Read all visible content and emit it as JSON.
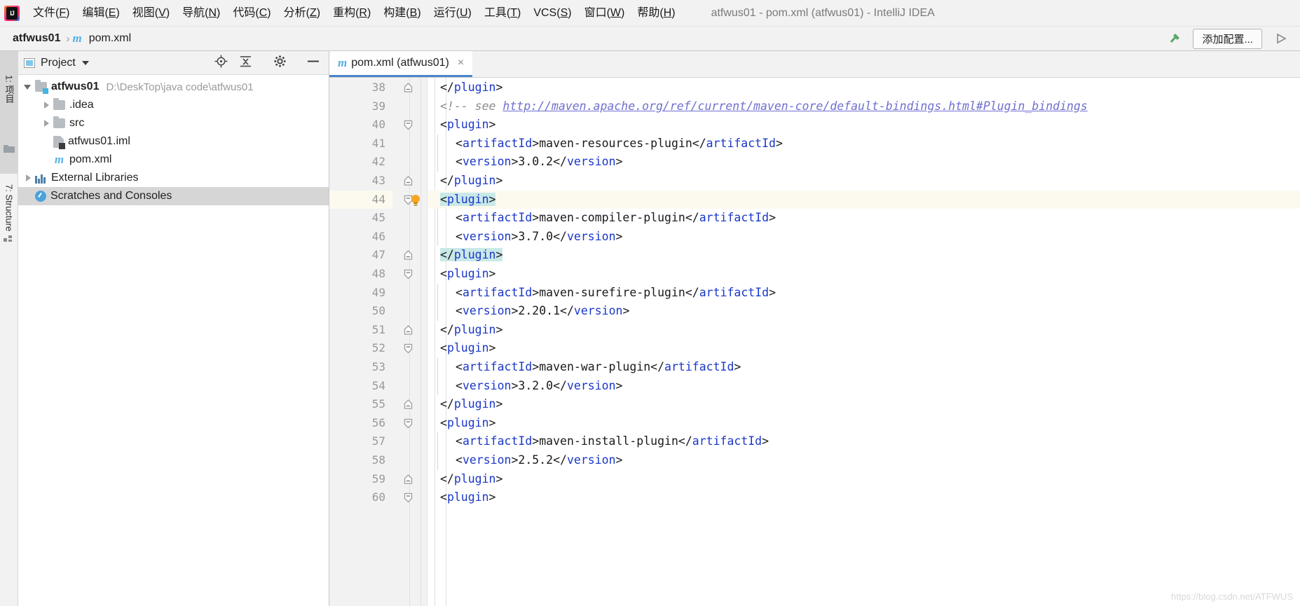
{
  "window": {
    "title": "atfwus01 - pom.xml (atfwus01) - IntelliJ IDEA",
    "logo_letters": "IJ"
  },
  "menubar": {
    "items": [
      {
        "label": "文件(F)",
        "mnemonic": "F"
      },
      {
        "label": "编辑(E)",
        "mnemonic": "E"
      },
      {
        "label": "视图(V)",
        "mnemonic": "V"
      },
      {
        "label": "导航(N)",
        "mnemonic": "N"
      },
      {
        "label": "代码(C)",
        "mnemonic": "C"
      },
      {
        "label": "分析(Z)",
        "mnemonic": "Z"
      },
      {
        "label": "重构(R)",
        "mnemonic": "R"
      },
      {
        "label": "构建(B)",
        "mnemonic": "B"
      },
      {
        "label": "运行(U)",
        "mnemonic": "U"
      },
      {
        "label": "工具(T)",
        "mnemonic": "T"
      },
      {
        "label": "VCS(S)",
        "mnemonic": "S"
      },
      {
        "label": "窗口(W)",
        "mnemonic": "W"
      },
      {
        "label": "帮助(H)",
        "mnemonic": "H"
      }
    ]
  },
  "navbar": {
    "breadcrumb": [
      {
        "label": "atfwus01",
        "icon": "none"
      },
      {
        "label": "pom.xml",
        "icon": "maven-m-icon"
      }
    ],
    "separator": "›",
    "add_configuration_label": "添加配置...",
    "build_icon": "hammer-icon",
    "run_icon": "run-triangle-icon",
    "accent": "#59a869"
  },
  "toolstrip": {
    "tabs": [
      {
        "label": "1: 项目",
        "selected": true,
        "icon": "folder-icon"
      },
      {
        "label": "7: Structure",
        "selected": false,
        "icon": "structure-icon"
      }
    ]
  },
  "project_panel": {
    "title": "Project",
    "header_icons": [
      "target-locate-icon",
      "collapse-all-icon",
      "gear-icon",
      "hide-icon"
    ],
    "tree": [
      {
        "label": "atfwus01",
        "path": "D:\\DeskTop\\java code\\atfwus01",
        "indent": 0,
        "arrow": "down",
        "icon": "module-folder-icon",
        "bold": true,
        "selected": false
      },
      {
        "label": ".idea",
        "path": "",
        "indent": 1,
        "arrow": "right",
        "icon": "folder-icon",
        "bold": false,
        "selected": false
      },
      {
        "label": "src",
        "path": "",
        "indent": 1,
        "arrow": "right",
        "icon": "folder-icon",
        "bold": false,
        "selected": false
      },
      {
        "label": "atfwus01.iml",
        "path": "",
        "indent": 1,
        "arrow": "none",
        "icon": "iml-file-icon",
        "bold": false,
        "selected": false
      },
      {
        "label": "pom.xml",
        "path": "",
        "indent": 1,
        "arrow": "none",
        "icon": "maven-m-icon",
        "bold": false,
        "selected": false
      },
      {
        "label": "External Libraries",
        "path": "",
        "indent": 0,
        "arrow": "right",
        "icon": "libraries-icon",
        "bold": false,
        "selected": false
      },
      {
        "label": "Scratches and Consoles",
        "path": "",
        "indent": 0,
        "arrow": "none",
        "icon": "scratches-icon",
        "bold": false,
        "selected": true
      }
    ]
  },
  "editor": {
    "tab": {
      "label": "pom.xml (atfwus01)",
      "icon": "maven-m-icon",
      "close": "×",
      "active_underline": "#4a86c8"
    },
    "first_line_number": 38,
    "highlighted_line": 44,
    "bulb_line": 44,
    "lines": [
      {
        "num": 38,
        "indent": 0,
        "fold": "end",
        "tokens": [
          {
            "t": "punct",
            "v": "</"
          },
          {
            "t": "tag",
            "v": "plugin"
          },
          {
            "t": "punct",
            "v": ">"
          }
        ]
      },
      {
        "num": 39,
        "indent": 0,
        "fold": "",
        "tokens": [
          {
            "t": "comment",
            "v": "<!-- see "
          },
          {
            "t": "url",
            "v": "http://maven.apache.org/ref/current/maven-core/default-bindings.html#Plugin_bindings"
          }
        ]
      },
      {
        "num": 40,
        "indent": 0,
        "fold": "start",
        "tokens": [
          {
            "t": "punct",
            "v": "<"
          },
          {
            "t": "tag",
            "v": "plugin"
          },
          {
            "t": "punct",
            "v": ">"
          }
        ]
      },
      {
        "num": 41,
        "indent": 1,
        "fold": "",
        "tokens": [
          {
            "t": "punct",
            "v": "<"
          },
          {
            "t": "tag",
            "v": "artifactId"
          },
          {
            "t": "punct",
            "v": ">"
          },
          {
            "t": "text",
            "v": "maven-resources-plugin"
          },
          {
            "t": "punct",
            "v": "</"
          },
          {
            "t": "tag",
            "v": "artifactId"
          },
          {
            "t": "punct",
            "v": ">"
          }
        ]
      },
      {
        "num": 42,
        "indent": 1,
        "fold": "",
        "tokens": [
          {
            "t": "punct",
            "v": "<"
          },
          {
            "t": "tag",
            "v": "version"
          },
          {
            "t": "punct",
            "v": ">"
          },
          {
            "t": "text",
            "v": "3.0.2"
          },
          {
            "t": "punct",
            "v": "</"
          },
          {
            "t": "tag",
            "v": "version"
          },
          {
            "t": "punct",
            "v": ">"
          }
        ]
      },
      {
        "num": 43,
        "indent": 0,
        "fold": "end",
        "tokens": [
          {
            "t": "punct",
            "v": "</"
          },
          {
            "t": "tag",
            "v": "plugin"
          },
          {
            "t": "punct",
            "v": ">"
          }
        ]
      },
      {
        "num": 44,
        "indent": 0,
        "fold": "start",
        "highlight": true,
        "brace": true,
        "tokens": [
          {
            "t": "punct",
            "v": "<"
          },
          {
            "t": "tag",
            "v": "plugin"
          },
          {
            "t": "punct",
            "v": ">"
          }
        ]
      },
      {
        "num": 45,
        "indent": 1,
        "fold": "",
        "tokens": [
          {
            "t": "punct",
            "v": "<"
          },
          {
            "t": "tag",
            "v": "artifactId"
          },
          {
            "t": "punct",
            "v": ">"
          },
          {
            "t": "text",
            "v": "maven-compiler-plugin"
          },
          {
            "t": "punct",
            "v": "</"
          },
          {
            "t": "tag",
            "v": "artifactId"
          },
          {
            "t": "punct",
            "v": ">"
          }
        ]
      },
      {
        "num": 46,
        "indent": 1,
        "fold": "",
        "tokens": [
          {
            "t": "punct",
            "v": "<"
          },
          {
            "t": "tag",
            "v": "version"
          },
          {
            "t": "punct",
            "v": ">"
          },
          {
            "t": "text",
            "v": "3.7.0"
          },
          {
            "t": "punct",
            "v": "</"
          },
          {
            "t": "tag",
            "v": "version"
          },
          {
            "t": "punct",
            "v": ">"
          }
        ]
      },
      {
        "num": 47,
        "indent": 0,
        "fold": "end",
        "brace": true,
        "tokens": [
          {
            "t": "punct",
            "v": "</"
          },
          {
            "t": "tag",
            "v": "plugin"
          },
          {
            "t": "punct",
            "v": ">"
          }
        ]
      },
      {
        "num": 48,
        "indent": 0,
        "fold": "start",
        "tokens": [
          {
            "t": "punct",
            "v": "<"
          },
          {
            "t": "tag",
            "v": "plugin"
          },
          {
            "t": "punct",
            "v": ">"
          }
        ]
      },
      {
        "num": 49,
        "indent": 1,
        "fold": "",
        "tokens": [
          {
            "t": "punct",
            "v": "<"
          },
          {
            "t": "tag",
            "v": "artifactId"
          },
          {
            "t": "punct",
            "v": ">"
          },
          {
            "t": "text",
            "v": "maven-surefire-plugin"
          },
          {
            "t": "punct",
            "v": "</"
          },
          {
            "t": "tag",
            "v": "artifactId"
          },
          {
            "t": "punct",
            "v": ">"
          }
        ]
      },
      {
        "num": 50,
        "indent": 1,
        "fold": "",
        "tokens": [
          {
            "t": "punct",
            "v": "<"
          },
          {
            "t": "tag",
            "v": "version"
          },
          {
            "t": "punct",
            "v": ">"
          },
          {
            "t": "text",
            "v": "2.20.1"
          },
          {
            "t": "punct",
            "v": "</"
          },
          {
            "t": "tag",
            "v": "version"
          },
          {
            "t": "punct",
            "v": ">"
          }
        ]
      },
      {
        "num": 51,
        "indent": 0,
        "fold": "end",
        "tokens": [
          {
            "t": "punct",
            "v": "</"
          },
          {
            "t": "tag",
            "v": "plugin"
          },
          {
            "t": "punct",
            "v": ">"
          }
        ]
      },
      {
        "num": 52,
        "indent": 0,
        "fold": "start",
        "tokens": [
          {
            "t": "punct",
            "v": "<"
          },
          {
            "t": "tag",
            "v": "plugin"
          },
          {
            "t": "punct",
            "v": ">"
          }
        ]
      },
      {
        "num": 53,
        "indent": 1,
        "fold": "",
        "tokens": [
          {
            "t": "punct",
            "v": "<"
          },
          {
            "t": "tag",
            "v": "artifactId"
          },
          {
            "t": "punct",
            "v": ">"
          },
          {
            "t": "text",
            "v": "maven-war-plugin"
          },
          {
            "t": "punct",
            "v": "</"
          },
          {
            "t": "tag",
            "v": "artifactId"
          },
          {
            "t": "punct",
            "v": ">"
          }
        ]
      },
      {
        "num": 54,
        "indent": 1,
        "fold": "",
        "tokens": [
          {
            "t": "punct",
            "v": "<"
          },
          {
            "t": "tag",
            "v": "version"
          },
          {
            "t": "punct",
            "v": ">"
          },
          {
            "t": "text",
            "v": "3.2.0"
          },
          {
            "t": "punct",
            "v": "</"
          },
          {
            "t": "tag",
            "v": "version"
          },
          {
            "t": "punct",
            "v": ">"
          }
        ]
      },
      {
        "num": 55,
        "indent": 0,
        "fold": "end",
        "tokens": [
          {
            "t": "punct",
            "v": "</"
          },
          {
            "t": "tag",
            "v": "plugin"
          },
          {
            "t": "punct",
            "v": ">"
          }
        ]
      },
      {
        "num": 56,
        "indent": 0,
        "fold": "start",
        "tokens": [
          {
            "t": "punct",
            "v": "<"
          },
          {
            "t": "tag",
            "v": "plugin"
          },
          {
            "t": "punct",
            "v": ">"
          }
        ]
      },
      {
        "num": 57,
        "indent": 1,
        "fold": "",
        "tokens": [
          {
            "t": "punct",
            "v": "<"
          },
          {
            "t": "tag",
            "v": "artifactId"
          },
          {
            "t": "punct",
            "v": ">"
          },
          {
            "t": "text",
            "v": "maven-install-plugin"
          },
          {
            "t": "punct",
            "v": "</"
          },
          {
            "t": "tag",
            "v": "artifactId"
          },
          {
            "t": "punct",
            "v": ">"
          }
        ]
      },
      {
        "num": 58,
        "indent": 1,
        "fold": "",
        "tokens": [
          {
            "t": "punct",
            "v": "<"
          },
          {
            "t": "tag",
            "v": "version"
          },
          {
            "t": "punct",
            "v": ">"
          },
          {
            "t": "text",
            "v": "2.5.2"
          },
          {
            "t": "punct",
            "v": "</"
          },
          {
            "t": "tag",
            "v": "version"
          },
          {
            "t": "punct",
            "v": ">"
          }
        ]
      },
      {
        "num": 59,
        "indent": 0,
        "fold": "end",
        "tokens": [
          {
            "t": "punct",
            "v": "</"
          },
          {
            "t": "tag",
            "v": "plugin"
          },
          {
            "t": "punct",
            "v": ">"
          }
        ]
      },
      {
        "num": 60,
        "indent": 0,
        "fold": "start",
        "tokens": [
          {
            "t": "punct",
            "v": "<"
          },
          {
            "t": "tag",
            "v": "plugin"
          },
          {
            "t": "punct",
            "v": ">"
          }
        ]
      }
    ]
  },
  "watermark": "https://blog.csdn.net/ATFWUS",
  "colors": {
    "tag": "#1a37c8",
    "comment": "#8c8c8c",
    "url": "#6f6fd0",
    "line_number": "#999999",
    "highlight_row": "#fcfaef",
    "brace_match": "#c9e8e8",
    "selection": "#d6d6d6",
    "maven_blue": "#52b0e5"
  }
}
